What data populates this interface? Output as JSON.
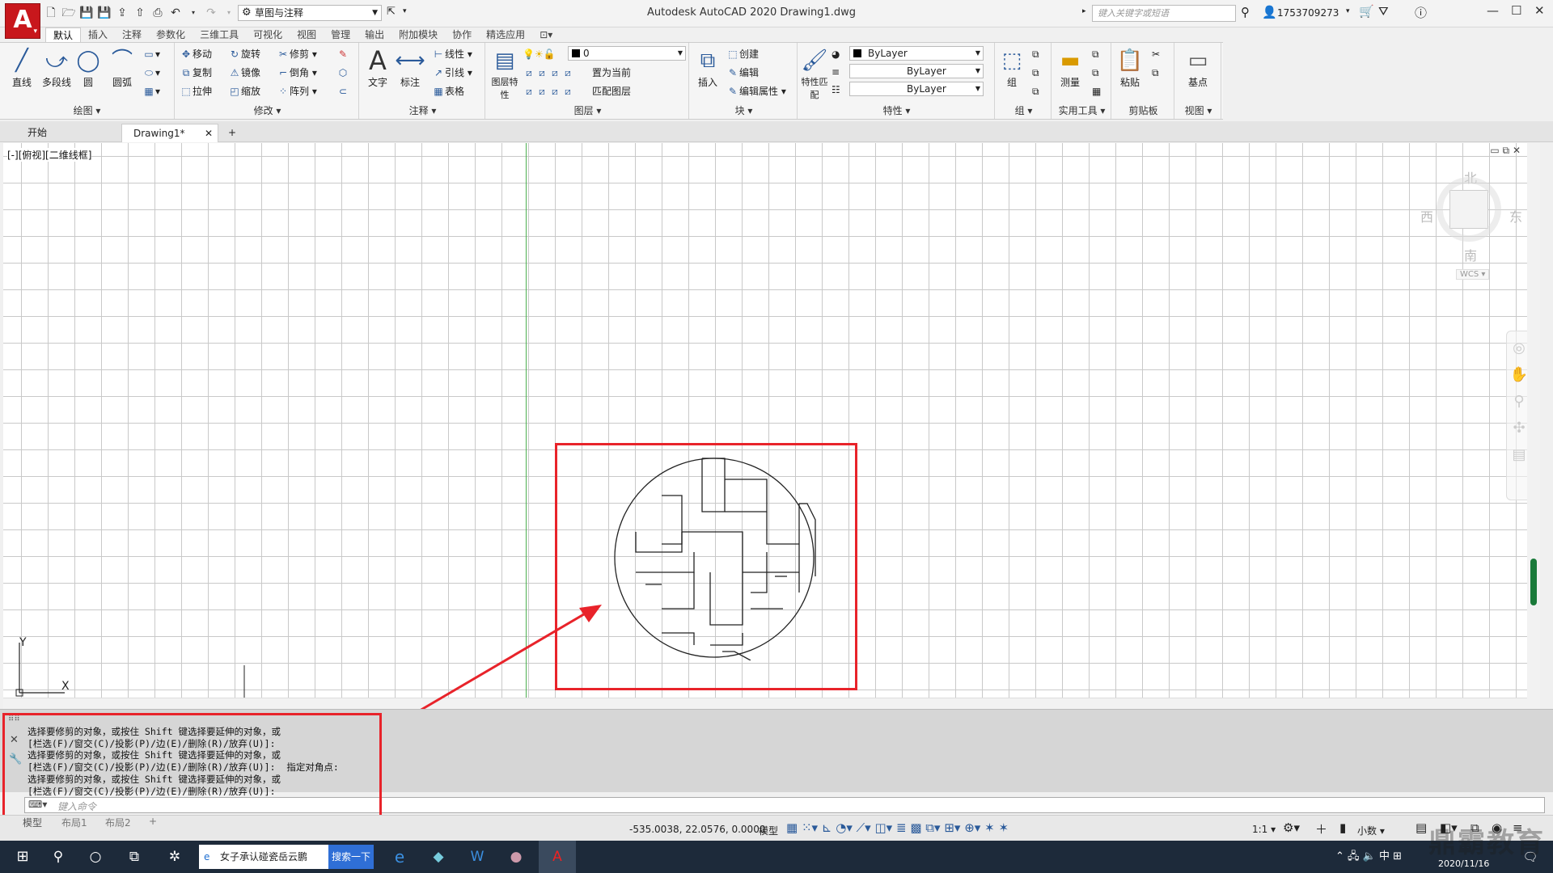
{
  "titlebar": {
    "app_logo": "A",
    "workspace": "草图与注释",
    "window_title": "Autodesk AutoCAD 2020    Drawing1.dwg",
    "search_placeholder": "键入关键字或短语",
    "user": "1753709273"
  },
  "ribbon_tabs": [
    "默认",
    "插入",
    "注释",
    "参数化",
    "三维工具",
    "可视化",
    "视图",
    "管理",
    "输出",
    "附加模块",
    "协作",
    "精选应用"
  ],
  "ribbon": {
    "draw": {
      "title": "绘图",
      "line": "直线",
      "polyline": "多段线",
      "circle": "圆",
      "arc": "圆弧"
    },
    "modify": {
      "title": "修改",
      "move": "移动",
      "rotate": "旋转",
      "trim": "修剪",
      "copy": "复制",
      "mirror": "镜像",
      "fillet": "倒角",
      "stretch": "拉伸",
      "scale": "缩放",
      "array": "阵列"
    },
    "annotation": {
      "title": "注释",
      "text": "文字",
      "dimension": "标注",
      "linear": "线性",
      "leader": "引线",
      "table": "表格"
    },
    "layers": {
      "title": "图层",
      "props": "图层特性",
      "layer_value": "0",
      "make_current": "置为当前",
      "match": "匹配图层"
    },
    "block": {
      "title": "块",
      "insert": "插入",
      "create": "创建",
      "edit": "编辑",
      "edit_attr": "编辑属性"
    },
    "properties": {
      "title": "特性",
      "match": "特性匹配",
      "color": "ByLayer",
      "linetype": "ByLayer",
      "lineweight": "ByLayer"
    },
    "groups": {
      "title": "组",
      "group": "组"
    },
    "utilities": {
      "title": "实用工具",
      "measure": "测量"
    },
    "clipboard": {
      "title": "剪贴板",
      "paste": "粘贴"
    },
    "view": {
      "title": "视图",
      "base": "基点"
    }
  },
  "doc_tabs": {
    "start": "开始",
    "drawing": "Drawing1*",
    "add": "+"
  },
  "viewport": {
    "label": "[-][俯视][二维线框]",
    "viewcube": {
      "north": "北",
      "south": "南",
      "east": "东",
      "west": "西",
      "wcs": "WCS"
    },
    "ucs": {
      "x": "X",
      "y": "Y"
    }
  },
  "command_line": {
    "history": [
      "选择要修剪的对象，或按住 Shift 键选择要延伸的对象，或",
      "[栏选(F)/窗交(C)/投影(P)/边(E)/删除(R)/放弃(U)]:",
      "选择要修剪的对象，或按住 Shift 键选择要延伸的对象，或",
      "[栏选(F)/窗交(C)/投影(P)/边(E)/删除(R)/放弃(U)]:  指定对角点:",
      "选择要修剪的对象，或按住 Shift 键选择要延伸的对象，或",
      "[栏选(F)/窗交(C)/投影(P)/边(E)/删除(R)/放弃(U)]:"
    ],
    "input_placeholder": "键入命令"
  },
  "layout_tabs": [
    "模型",
    "布局1",
    "布局2",
    "+"
  ],
  "status_bar": {
    "coords": "-535.0038, 22.0576, 0.0000",
    "model": "模型",
    "scale": "1:1",
    "units": "小数"
  },
  "taskbar": {
    "browser_text": "女子承认碰瓷岳云鹏",
    "search_btn": "搜索一下",
    "time": "2020/11/16",
    "lang": "中"
  },
  "watermark": "鼎霸教育",
  "colors": {
    "accent": "#c8171c",
    "highlight": "#e8232a"
  }
}
